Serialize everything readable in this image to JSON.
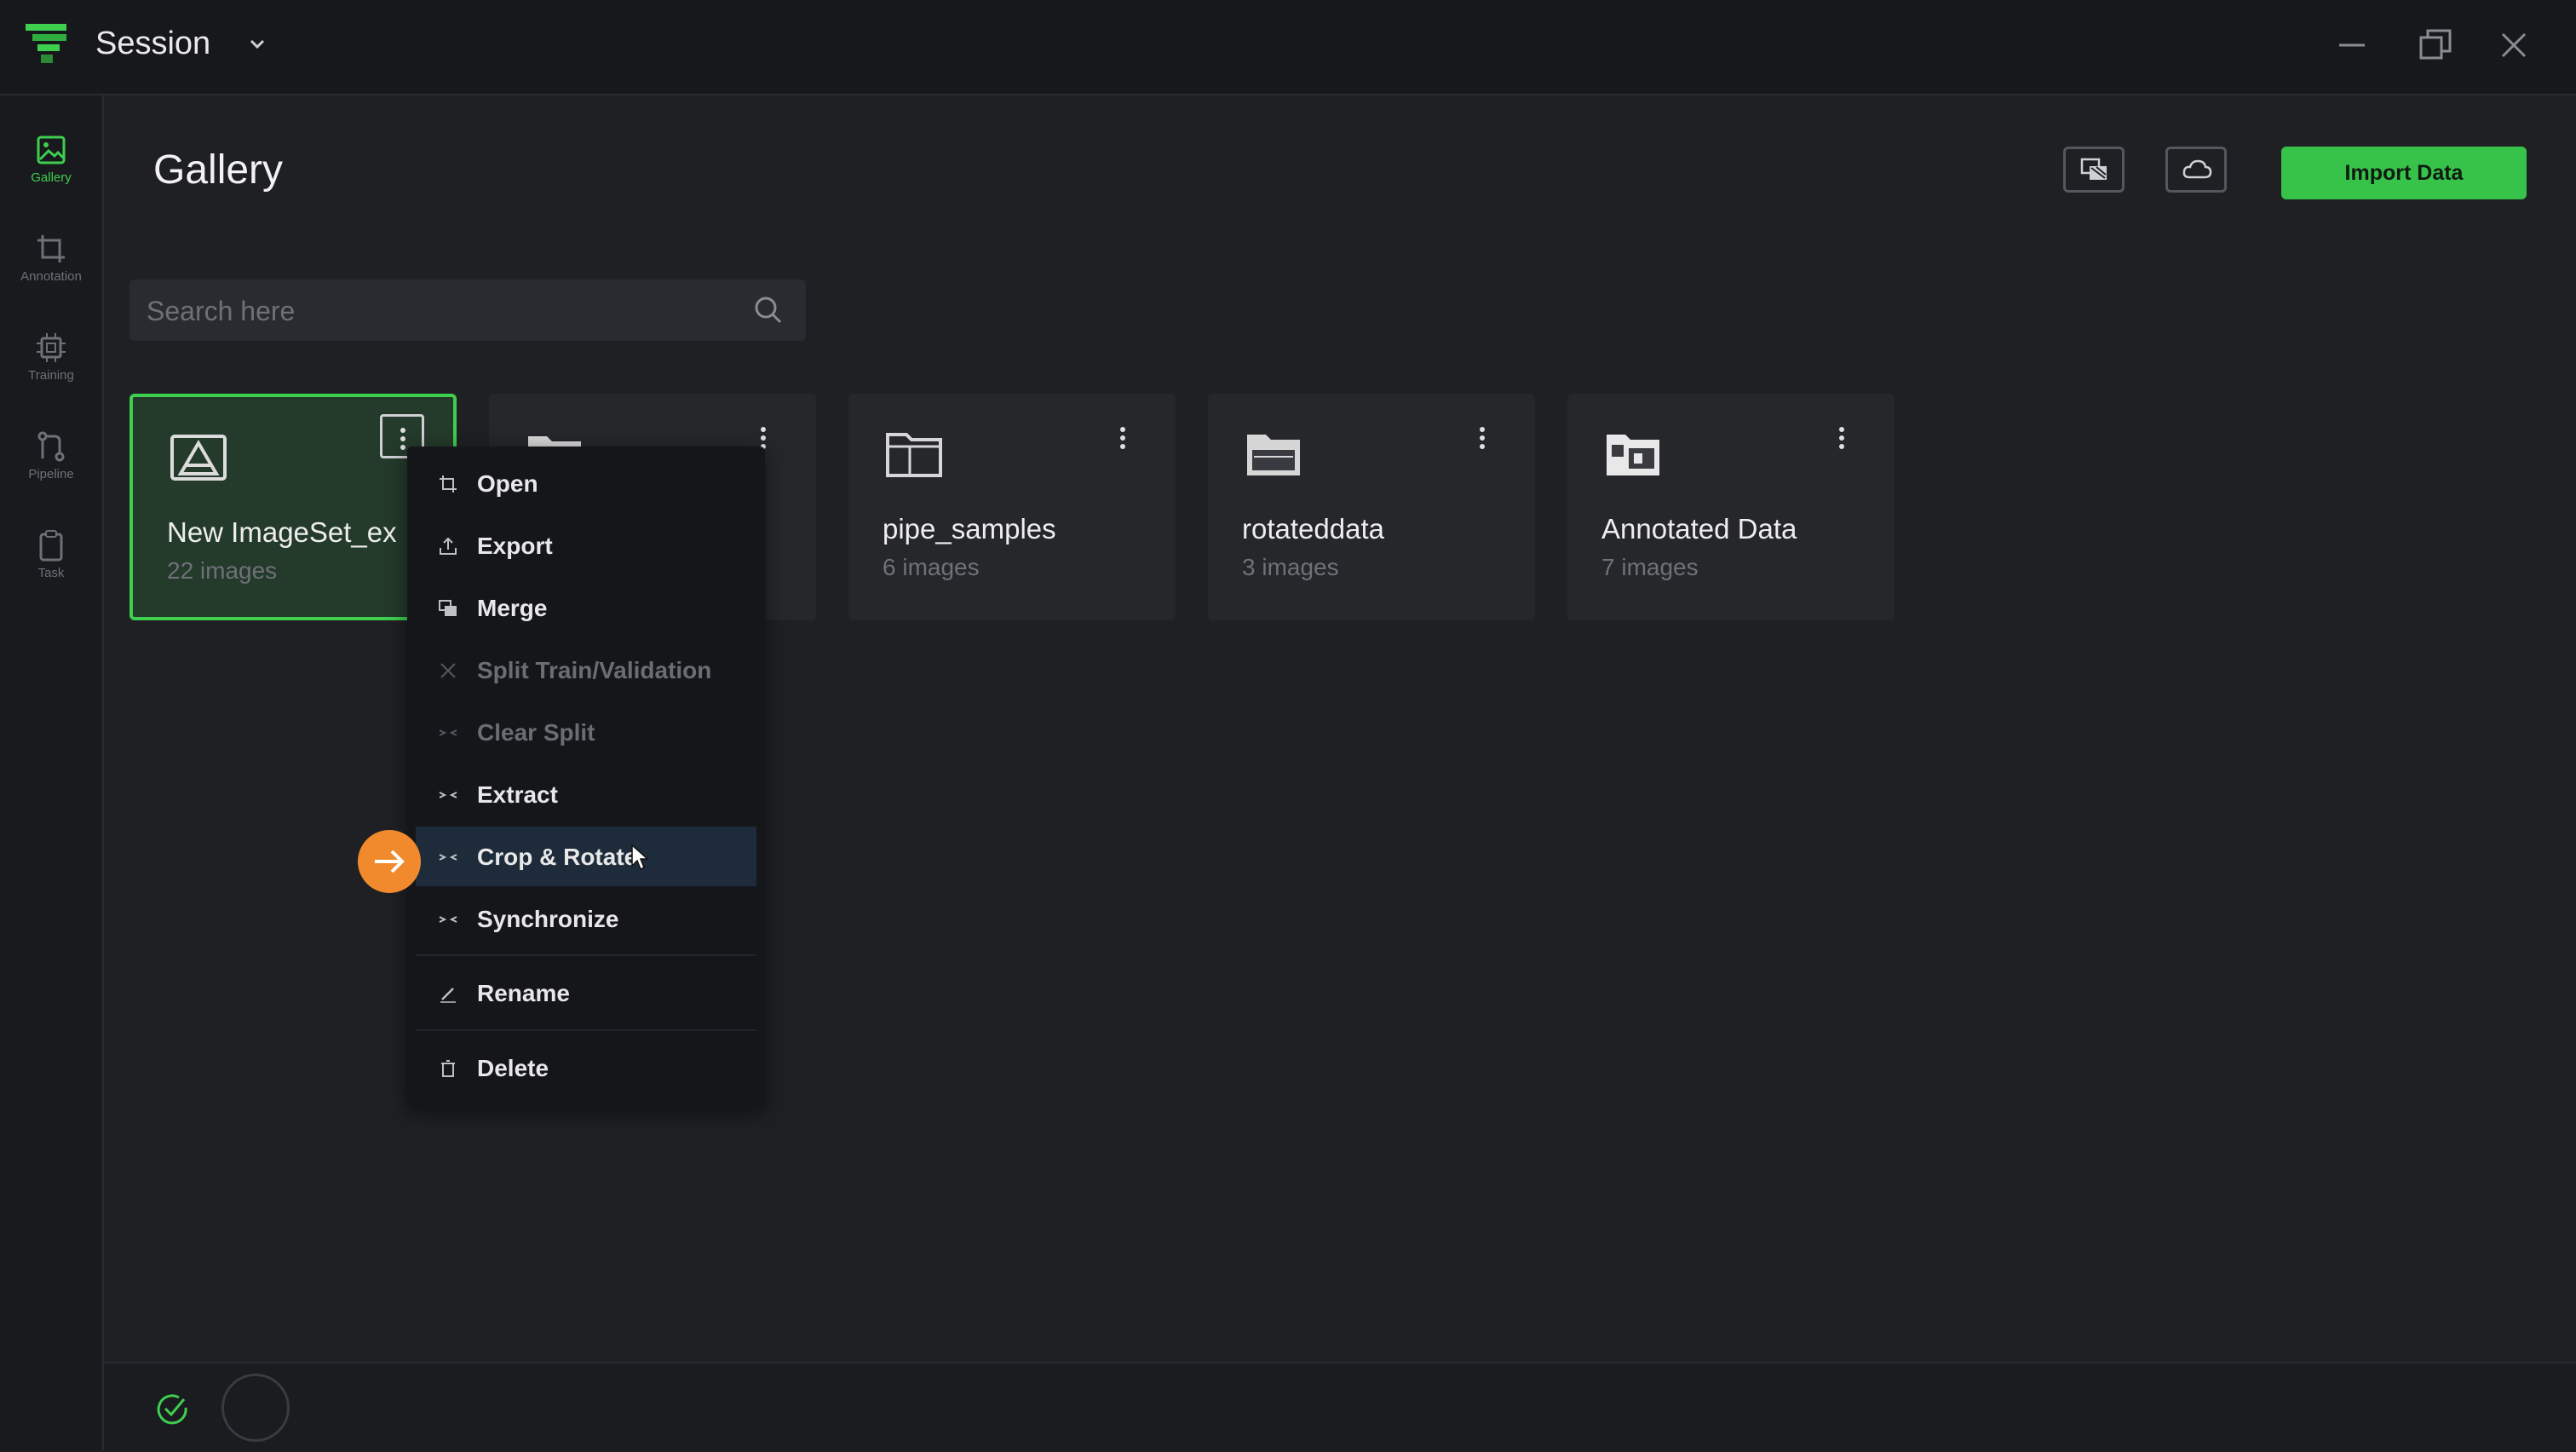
{
  "window": {
    "title": "Session"
  },
  "sidebar": {
    "items": [
      {
        "label": "Gallery",
        "icon": "image-icon",
        "active": true
      },
      {
        "label": "Annotation",
        "icon": "crop-icon",
        "active": false
      },
      {
        "label": "Training",
        "icon": "chip-icon",
        "active": false
      },
      {
        "label": "Pipeline",
        "icon": "pipeline-icon",
        "active": false
      },
      {
        "label": "Task",
        "icon": "clipboard-icon",
        "active": false
      }
    ]
  },
  "header": {
    "title": "Gallery",
    "import_label": "Import Data"
  },
  "search": {
    "placeholder": "Search here",
    "value": ""
  },
  "cards": [
    {
      "name": "New ImageSet_ex",
      "count": "22 images",
      "icon": "dataset-icon",
      "selected": true
    },
    {
      "name": "",
      "count": "",
      "icon": "folder-icon",
      "selected": false
    },
    {
      "name": "pipe_samples",
      "count": "6 images",
      "icon": "folder-icon",
      "selected": false
    },
    {
      "name": "rotateddata",
      "count": "3 images",
      "icon": "folder-open-icon",
      "selected": false
    },
    {
      "name": "Annotated Data",
      "count": "7 images",
      "icon": "annotated-folder-icon",
      "selected": false
    }
  ],
  "context_menu": {
    "items": [
      {
        "label": "Open",
        "icon": "crop-icon",
        "enabled": true
      },
      {
        "label": "Export",
        "icon": "upload-icon",
        "enabled": true
      },
      {
        "label": "Merge",
        "icon": "merge-icon",
        "enabled": true
      },
      {
        "label": "Split Train/Validation",
        "icon": "split-icon",
        "enabled": false
      },
      {
        "label": "Clear Split",
        "icon": "arrows-in-icon",
        "enabled": false
      },
      {
        "label": "Extract",
        "icon": "arrows-in-icon",
        "enabled": true
      },
      {
        "label": "Crop & Rotate",
        "icon": "arrows-in-icon",
        "enabled": true,
        "hovered": true
      },
      {
        "label": "Synchronize",
        "icon": "arrows-in-icon",
        "enabled": true
      },
      {
        "label": "Rename",
        "icon": "pencil-icon",
        "enabled": true
      },
      {
        "label": "Delete",
        "icon": "trash-icon",
        "enabled": true
      }
    ]
  },
  "colors": {
    "accent": "#3ecf4f",
    "import_button": "#37c24a",
    "pointer": "#f08a2c",
    "background": "#1f2024"
  }
}
